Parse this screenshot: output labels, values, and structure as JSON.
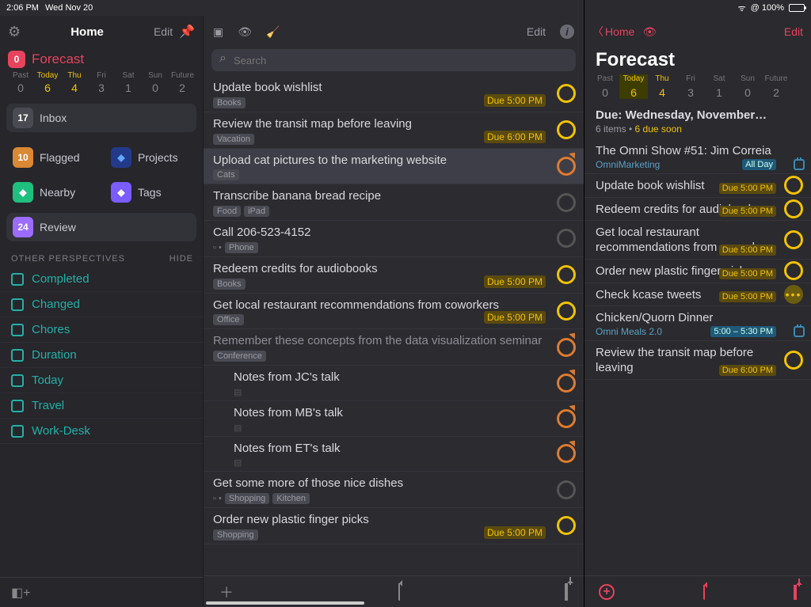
{
  "left_status": {
    "time": "2:06 PM",
    "date": "Wed Nov 20"
  },
  "right_status": {
    "net": "ᯤ",
    "battery": "@ 100%"
  },
  "sidebar": {
    "title": "Home",
    "edit": "Edit",
    "forecast": {
      "badge": "0",
      "label": "Forecast"
    },
    "days": [
      {
        "lbl": "Past",
        "num": "0"
      },
      {
        "lbl": "Today",
        "num": "6",
        "hot": true
      },
      {
        "lbl": "Thu",
        "num": "4",
        "hot": true
      },
      {
        "lbl": "Fri",
        "num": "3"
      },
      {
        "lbl": "Sat",
        "num": "1"
      },
      {
        "lbl": "Sun",
        "num": "0"
      },
      {
        "lbl": "Future",
        "num": "2"
      }
    ],
    "inbox": {
      "badge": "17",
      "label": "Inbox"
    },
    "tiles": [
      {
        "badge": "10",
        "label": "Flagged",
        "bg": "bg-orange"
      },
      {
        "icon": true,
        "label": "Projects",
        "bg": "bg-darkblue"
      },
      {
        "icon": true,
        "label": "Nearby",
        "bg": "bg-green"
      },
      {
        "icon": true,
        "label": "Tags",
        "bg": "bg-purple"
      },
      {
        "badge": "24",
        "label": "Review",
        "bg": "bg-purple2",
        "full": true
      }
    ],
    "perspect_head": "OTHER PERSPECTIVES",
    "hide": "HIDE",
    "perspectives": [
      "Completed",
      "Changed",
      "Chores",
      "Duration",
      "Today",
      "Travel",
      "Work-Desk"
    ]
  },
  "mid": {
    "edit": "Edit",
    "search_placeholder": "Search",
    "tasks": [
      {
        "t": "Update book wishlist",
        "tags": [
          "Books"
        ],
        "due": "Due 5:00 PM",
        "c": "c-yellow"
      },
      {
        "t": "Review the transit map before leaving",
        "tags": [
          "Vacation"
        ],
        "due": "Due 6:00 PM",
        "c": "c-yellow"
      },
      {
        "t": "Upload cat pictures to the marketing website",
        "tags": [
          "Cats"
        ],
        "c": "c-orange",
        "sel": true,
        "flag": true
      },
      {
        "t": "Transcribe banana bread recipe",
        "tags": [
          "Food",
          "iPad"
        ],
        "c": "c-grey"
      },
      {
        "t": "Call 206-523-4152",
        "tags": [
          "Phone"
        ],
        "c": "c-grey",
        "dotprefix": true
      },
      {
        "t": "Redeem credits for audiobooks",
        "tags": [
          "Books"
        ],
        "due": "Due 5:00 PM",
        "c": "c-yellow"
      },
      {
        "t": "Get local restaurant recommendations from coworkers",
        "tags": [
          "Office"
        ],
        "due": "Due 5:00 PM",
        "c": "c-yellow"
      },
      {
        "t": "Remember these concepts from the data visualization seminar",
        "tags": [
          "Conference"
        ],
        "c": "c-orange",
        "dim": true,
        "flag": true
      },
      {
        "t": "Notes from JC's talk",
        "tags": [],
        "c": "c-orange",
        "flag": true,
        "indent": true,
        "note": true
      },
      {
        "t": "Notes from MB's talk",
        "tags": [],
        "c": "c-orange",
        "flag": true,
        "indent": true,
        "note": true
      },
      {
        "t": "Notes from ET's talk",
        "tags": [],
        "c": "c-orange",
        "flag": true,
        "indent": true,
        "note": true
      },
      {
        "t": "Get some more of those nice dishes",
        "tags": [
          "Shopping",
          "Kitchen"
        ],
        "c": "c-grey",
        "dotprefix": true
      },
      {
        "t": "Order new plastic finger picks",
        "tags": [
          "Shopping"
        ],
        "due": "Due 5:00 PM",
        "c": "c-yellow"
      }
    ]
  },
  "right": {
    "back": "Home",
    "edit": "Edit",
    "title": "Forecast",
    "days": [
      {
        "lbl": "Past",
        "num": "0"
      },
      {
        "lbl": "Today",
        "num": "6",
        "sel": true
      },
      {
        "lbl": "Thu",
        "num": "4",
        "hot": true
      },
      {
        "lbl": "Fri",
        "num": "3"
      },
      {
        "lbl": "Sat",
        "num": "1"
      },
      {
        "lbl": "Sun",
        "num": "0"
      },
      {
        "lbl": "Future",
        "num": "2"
      }
    ],
    "section_head": "Due: Wednesday, November…",
    "section_sub_a": "6 items • ",
    "section_sub_b": "6 due soon",
    "items": [
      {
        "t": "The Omni Show #51: Jim Correia",
        "proj": "OmniMarketing",
        "time": "All Day",
        "timecls": "allday",
        "cal": true
      },
      {
        "t": "Update book wishlist",
        "time": "Due 5:00 PM",
        "timecls": "soon",
        "circle": "c-yellow"
      },
      {
        "t": "Redeem credits for audiobooks",
        "time": "Due 5:00 PM",
        "timecls": "soon",
        "circle": "c-yellow"
      },
      {
        "t": "Get local restaurant recommendations from coworkers",
        "time": "Due 5:00 PM",
        "timecls": "soon",
        "circle": "c-yellow"
      },
      {
        "t": "Order new plastic finger picks",
        "time": "Due 5:00 PM",
        "timecls": "soon",
        "circle": "c-yellow"
      },
      {
        "t": "Check kcase tweets",
        "time": "Due 5:00 PM",
        "timecls": "soon",
        "dots": true
      },
      {
        "t": "Chicken/Quorn Dinner",
        "proj": "Omni Meals 2.0",
        "time": "5:00 – 5:30 PM",
        "timecls": "range",
        "cal": true
      },
      {
        "t": "Review the transit map before leaving",
        "time": "Due 6:00 PM",
        "timecls": "soon",
        "circle": "c-yellow"
      }
    ]
  }
}
